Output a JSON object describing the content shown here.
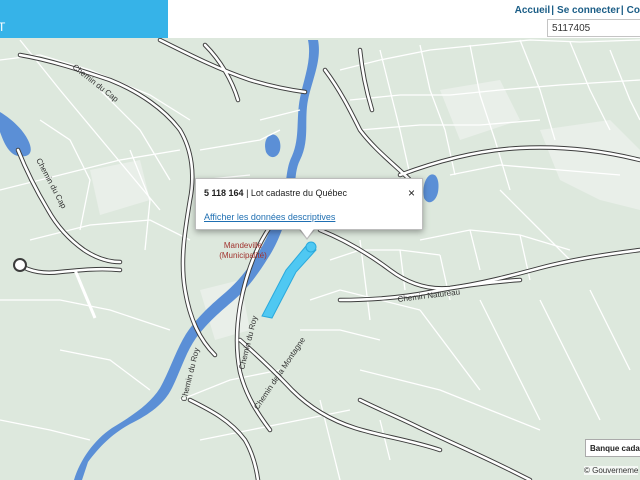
{
  "header": {
    "app_title": "T",
    "nav": {
      "home": "Accueil",
      "login": "Se connecter",
      "more": "Co"
    },
    "search_value": "5117405"
  },
  "popup": {
    "lot_number": "5 118 164",
    "lot_type": "| Lot cadastre du Québec",
    "link": "Afficher les données descriptives",
    "close": "×"
  },
  "map": {
    "labels": {
      "road_chemin_du_cap_1": "Chemin du Cap",
      "road_chemin_du_cap_2": "Chemin du Cap",
      "municipality_name": "Mandeville",
      "municipality_type": "(Municipalité)",
      "road_chemin_du_roy_1": "Chemin du Roy",
      "road_chemin_du_roy_2": "Chemin du Roy",
      "road_chemin_montagne": "Chemin de la Montagne",
      "road_chemin_nature": "Chemin Natureau"
    },
    "colors": {
      "land": "#dde8dd",
      "water": "#5b8fd6",
      "parcel_line": "#ffffff",
      "road": "#3c3c3c",
      "highlight": "#4fc8f2"
    }
  },
  "layer_button": "Banque cada",
  "attribution": "© Gouverneme"
}
